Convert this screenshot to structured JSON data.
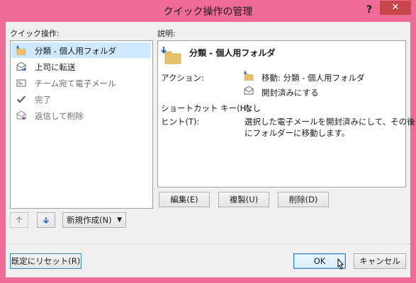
{
  "window": {
    "title": "クイック操作の管理",
    "help": "?",
    "close": "✕"
  },
  "left": {
    "label": "クイック操作:",
    "items": [
      {
        "label": "分類 - 個人用フォルダ",
        "icon": "folder-move-icon",
        "selected": true
      },
      {
        "label": "上司に転送",
        "icon": "forward-mail-icon",
        "selected": false
      },
      {
        "label": "チーム宛て電子メール",
        "icon": "team-email-icon",
        "selected": false
      },
      {
        "label": "完了",
        "icon": "checkmark-icon",
        "selected": false
      },
      {
        "label": "返信して削除",
        "icon": "reply-delete-icon",
        "selected": false
      }
    ]
  },
  "desc": {
    "label": "説明:",
    "title": "分類 - 個人用フォルダ",
    "action_label": "アクション:",
    "actions": [
      "移動: 分類 - 個人用フォルダ",
      "開封済みにする"
    ],
    "shortcut_label": "ショートカット キー(H):",
    "shortcut_value": "なし",
    "hint_label": "ヒント(T):",
    "hint_line1": "選択した電子メールを開封済みにして、その後",
    "hint_line2": "にフォルダーに移動します。"
  },
  "buttons": {
    "edit": "編集(E)",
    "duplicate": "複製(U)",
    "delete": "削除(D)",
    "new": "新規作成(N)",
    "reset": "既定にリセット(R)",
    "ok": "OK",
    "cancel": "キャンセル"
  },
  "colors": {
    "frame": "#ee6b97",
    "close": "#c7464b",
    "selection": "#cde8ff",
    "arrow": "#2a6ab8",
    "folder": "#e8c06a"
  }
}
